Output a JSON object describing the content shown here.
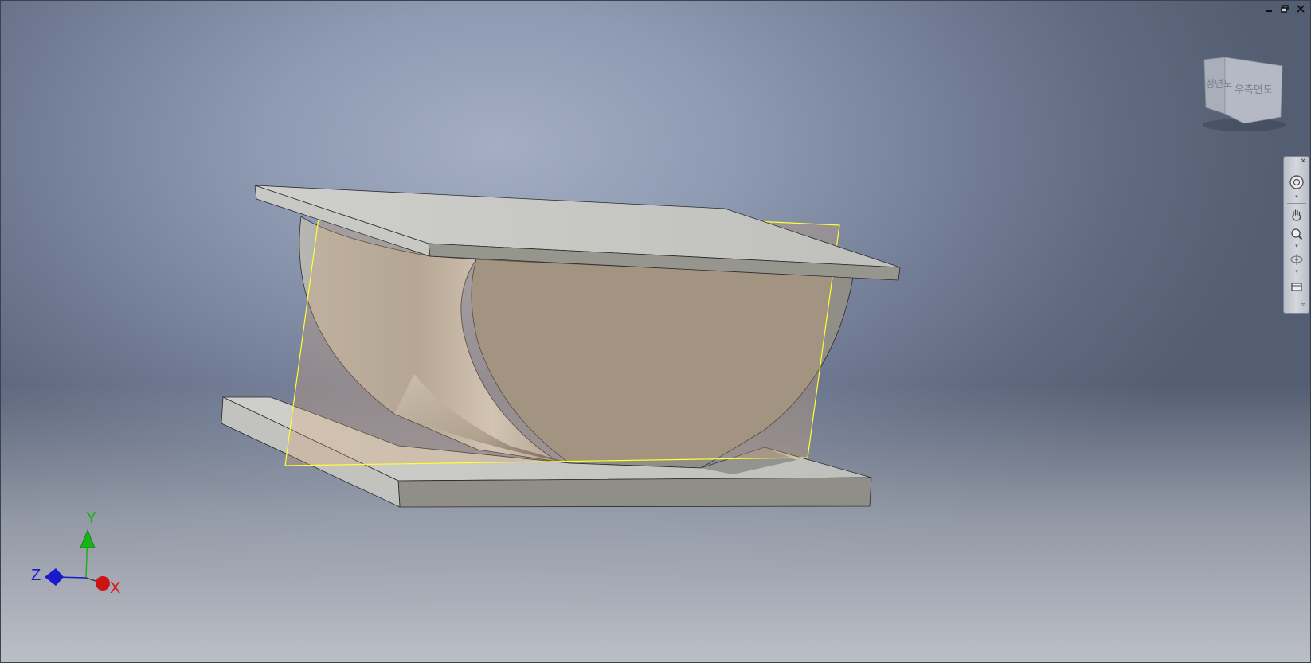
{
  "window_controls": {
    "minimize": "minimize-icon",
    "restore": "restore-icon",
    "close": "close-icon"
  },
  "viewcube": {
    "front_label": "정면도",
    "right_label": "우측면도"
  },
  "axes": {
    "x": "X",
    "y": "Y",
    "z": "Z",
    "colors": {
      "x": "#e01515",
      "y": "#17b317",
      "z": "#1a1acc"
    }
  },
  "nav_bar": {
    "items": [
      {
        "icon": "steering-wheel-icon"
      },
      {
        "icon": "pan-hand-icon"
      },
      {
        "icon": "zoom-icon"
      },
      {
        "icon": "orbit-icon"
      },
      {
        "icon": "look-at-icon"
      }
    ]
  },
  "colors": {
    "part_face": "#8f8f88",
    "part_light": "#c5c5c1",
    "sketch_plane": "#d8a26f",
    "plane_outline": "#ffff33"
  }
}
